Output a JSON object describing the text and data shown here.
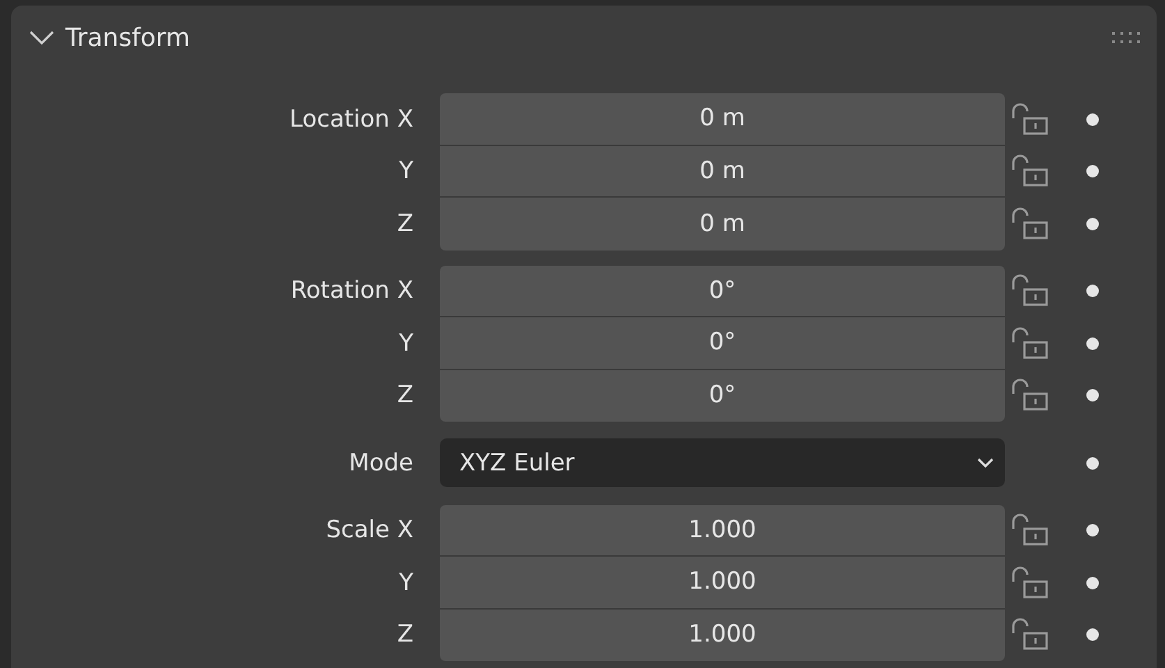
{
  "panel": {
    "title": "Transform",
    "expanded": true
  },
  "groups": [
    {
      "kind": "vector",
      "rows": [
        {
          "label": "Location X",
          "value": "0 m",
          "locked": false
        },
        {
          "label": "Y",
          "value": "0 m",
          "locked": false
        },
        {
          "label": "Z",
          "value": "0 m",
          "locked": false
        }
      ]
    },
    {
      "kind": "vector",
      "rows": [
        {
          "label": "Rotation X",
          "value": "0°",
          "locked": false
        },
        {
          "label": "Y",
          "value": "0°",
          "locked": false
        },
        {
          "label": "Z",
          "value": "0°",
          "locked": false
        }
      ]
    },
    {
      "kind": "enum",
      "rows": [
        {
          "label": "Mode",
          "value": "XYZ Euler"
        }
      ]
    },
    {
      "kind": "vector",
      "rows": [
        {
          "label": "Scale X",
          "value": "1.000",
          "locked": false
        },
        {
          "label": "Y",
          "value": "1.000",
          "locked": false
        },
        {
          "label": "Z",
          "value": "1.000",
          "locked": false
        }
      ]
    }
  ]
}
